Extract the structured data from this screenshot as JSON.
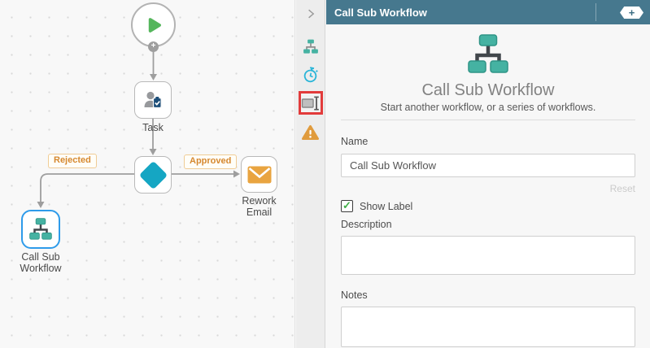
{
  "canvas": {
    "task_label": "Task",
    "rework_email_label": "Rework Email",
    "call_sub_workflow_label": "Call Sub Workflow",
    "rejected_label": "Rejected",
    "approved_label": "Approved",
    "start_port_glyph": "+"
  },
  "panel": {
    "header": {
      "title": "Call Sub Workflow",
      "add_button_glyph": "+"
    },
    "hero": {
      "title": "Call Sub Workflow",
      "subtitle": "Start another workflow, or a series of workflows."
    },
    "name_field": {
      "label": "Name",
      "value": "Call Sub Workflow",
      "reset_label": "Reset"
    },
    "show_label_checkbox": {
      "label": "Show Label",
      "checked": true,
      "check_glyph": "✓"
    },
    "description_field": {
      "label": "Description",
      "value": ""
    },
    "notes_field": {
      "label": "Notes",
      "value": ""
    }
  },
  "colors": {
    "header_bg": "#46788e",
    "accent_teal": "#45b2a2",
    "accent_cyan": "#15a6c3",
    "play_green": "#55b65c",
    "envelope_orange": "#e9a440",
    "warning_orange": "#e09b3d",
    "selection_blue": "#2e9bea",
    "highlight_red": "#e23b3b",
    "branch_label_orange": "#d6882f"
  }
}
